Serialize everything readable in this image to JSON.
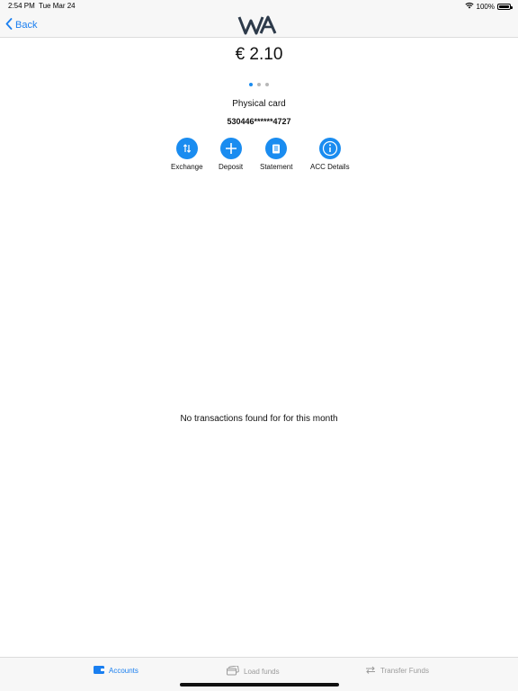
{
  "status_bar": {
    "time": "2:54 PM",
    "date": "Tue Mar 24",
    "battery": "100%",
    "battery_level": 1.0
  },
  "nav": {
    "back_label": "Back",
    "accent_color": "#1a7ff0"
  },
  "account": {
    "balance": "€ 2.10",
    "card_type": "Physical card",
    "card_number": "530446******4727",
    "pager": {
      "count": 3,
      "active_index": 0
    }
  },
  "actions": [
    {
      "label": "Exchange",
      "icon": "exchange-arrows-icon"
    },
    {
      "label": "Deposit",
      "icon": "plus-icon"
    },
    {
      "label": "Statement",
      "icon": "document-icon"
    },
    {
      "label": "ACC Details",
      "icon": "info-icon"
    }
  ],
  "transactions": {
    "empty_message": "No transactions found for for this month"
  },
  "tab_bar": {
    "tabs": [
      {
        "label": "Accounts",
        "icon": "wallet-icon",
        "active": true
      },
      {
        "label": "Load funds",
        "icon": "cards-icon",
        "active": false
      },
      {
        "label": "Transfer Funds",
        "icon": "transfer-arrows-icon",
        "active": false
      }
    ]
  }
}
